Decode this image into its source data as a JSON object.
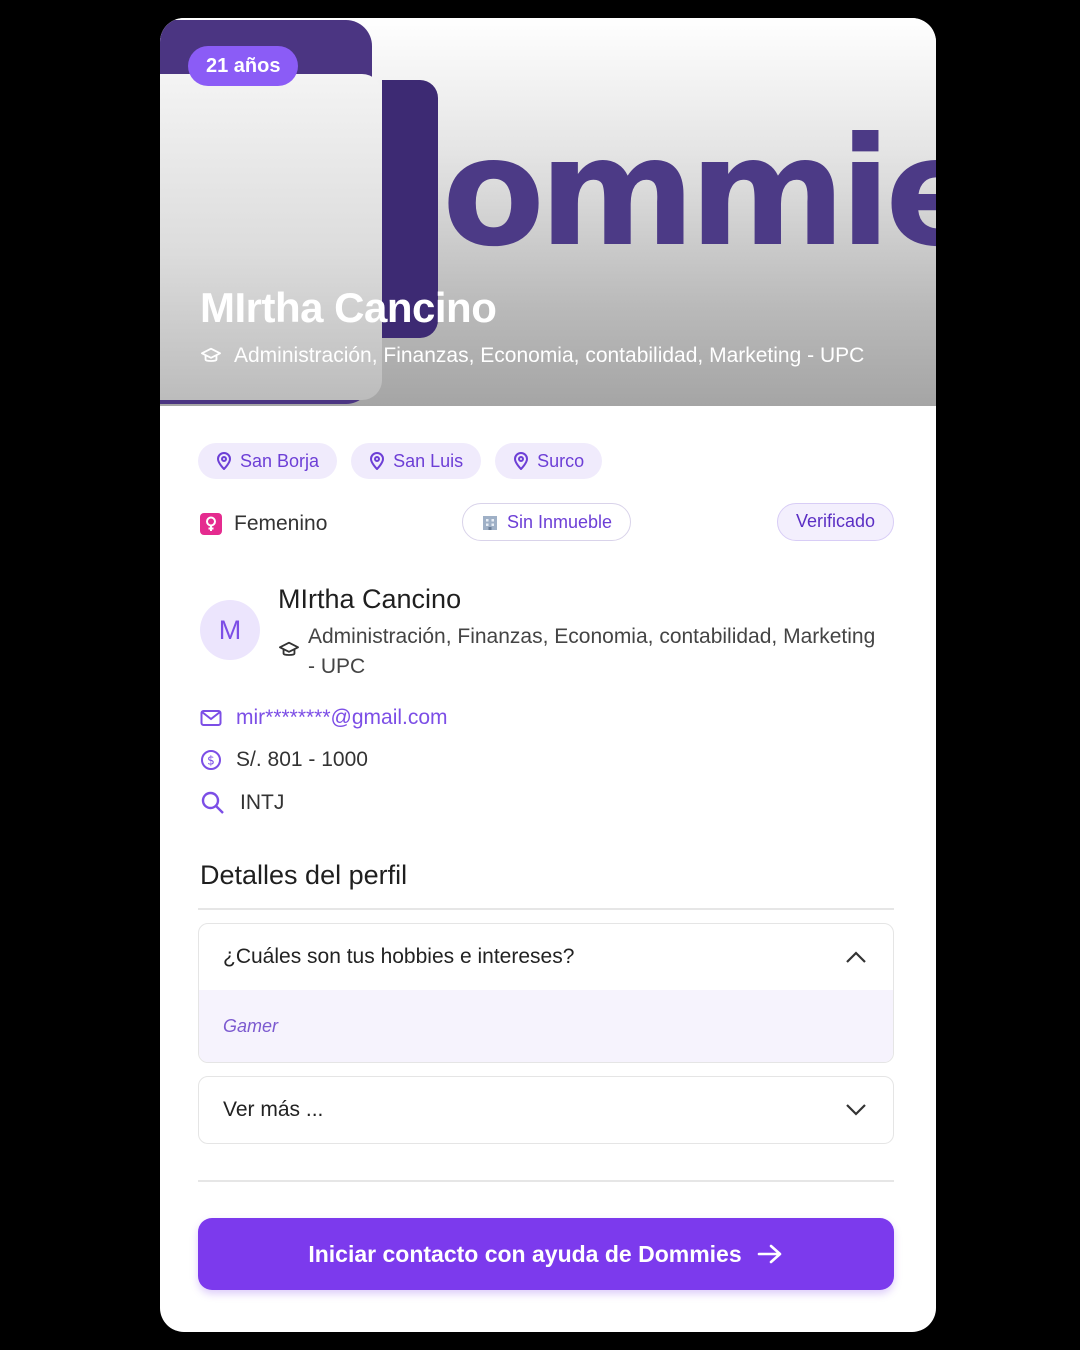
{
  "profile": {
    "age_badge": "21 años",
    "name": "MIrtha Cancino",
    "study": "Administración, Finanzas, Economia, contabilidad, Marketing - UPC",
    "logo_text": "ommie"
  },
  "locations": [
    {
      "label": "San Borja",
      "icon": "location-pin-icon"
    },
    {
      "label": "San Luis",
      "icon": "location-pin-icon"
    },
    {
      "label": "Surco",
      "icon": "location-pin-icon"
    }
  ],
  "tags": {
    "gender": "Femenino",
    "property": "Sin Inmueble",
    "verified": "Verificado"
  },
  "contact": {
    "avatar_initial": "M",
    "name": "MIrtha Cancino",
    "study": "Administración, Finanzas, Economia, contabilidad, Marketing - UPC",
    "email": "mir********@gmail.com",
    "salary": "S/. 801 - 1000",
    "personality": "INTJ"
  },
  "details": {
    "title": "Detalles del perfil",
    "accordion": [
      {
        "question": "¿Cuáles son tus hobbies e intereses?",
        "answer": "Gamer",
        "expanded": true
      },
      {
        "question": "Ver más ...",
        "expanded": false
      }
    ]
  },
  "cta": {
    "label": "Iniciar contacto con ayuda de Dommies"
  },
  "colors": {
    "accent": "#7c3aed",
    "accent_soft": "#f0ebfc",
    "gender_icon": "#e52b8f",
    "logo": "#4c3a86"
  }
}
